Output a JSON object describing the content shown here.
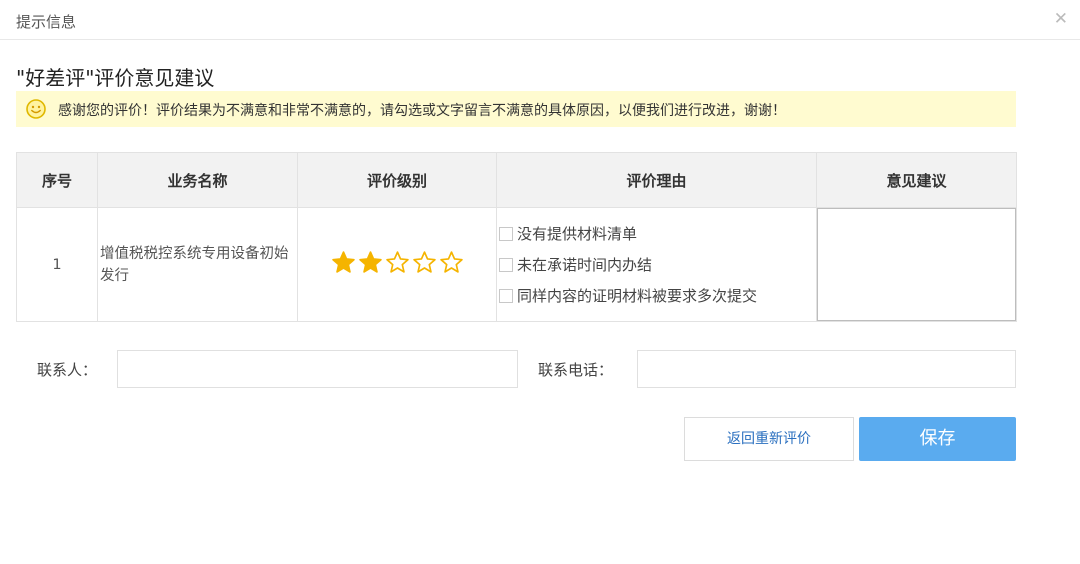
{
  "dialog": {
    "title": "提示信息",
    "close_icon": "close-icon"
  },
  "heading": "\"好差评\"评价意见建议",
  "notice": {
    "icon": "smiley-icon",
    "text": "感谢您的评价！评价结果为不满意和非常不满意的，请勾选或文字留言不满意的具体原因，以便我们进行改进，谢谢！",
    "background": "#fffbd0"
  },
  "table": {
    "headers": [
      "序号",
      "业务名称",
      "评价级别",
      "评价理由",
      "意见建议"
    ],
    "row": {
      "no": "1",
      "name": "增值税税控系统专用设备初始发行",
      "rating": 2,
      "max_rating": 5,
      "reasons": [
        "没有提供材料清单",
        "未在承诺时间内办结",
        "同样内容的证明材料被要求多次提交"
      ],
      "suggestion": ""
    }
  },
  "contact": {
    "person_label": "联系人：",
    "person_value": "",
    "phone_label": "联系电话：",
    "phone_value": ""
  },
  "buttons": {
    "back": "返回重新评价",
    "save": "保存"
  },
  "colors": {
    "star": "#f5b400",
    "save_button": "#5aabef",
    "link_text": "#2a6fbf"
  }
}
